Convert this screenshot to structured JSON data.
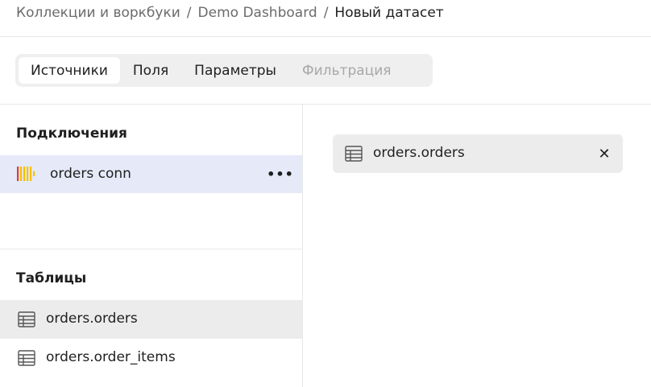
{
  "breadcrumb": {
    "items": [
      "Коллекции и воркбуки",
      "Demo Dashboard"
    ],
    "separator": "/",
    "current": "Новый датасет"
  },
  "tabs": [
    {
      "label": "Источники",
      "state": "active"
    },
    {
      "label": "Поля",
      "state": "normal"
    },
    {
      "label": "Параметры",
      "state": "normal"
    },
    {
      "label": "Фильтрация",
      "state": "disabled"
    }
  ],
  "connections": {
    "title": "Подключения",
    "items": [
      {
        "label": "orders conn",
        "icon": "clickhouse-icon",
        "more": "•••"
      }
    ]
  },
  "tables": {
    "title": "Таблицы",
    "items": [
      {
        "label": "orders.orders",
        "icon": "table-icon"
      },
      {
        "label": "orders.order_items",
        "icon": "table-icon"
      }
    ]
  },
  "workspace": {
    "source": {
      "label": "orders.orders",
      "icon": "table-icon",
      "close": "✕"
    }
  },
  "colors": {
    "selected_connection_bg": "#e5e9f8",
    "selected_table_bg": "#ececec",
    "clickhouse_yellow": "#f5c000",
    "clickhouse_red": "#e53935",
    "muted_text": "#6b6b6b"
  }
}
